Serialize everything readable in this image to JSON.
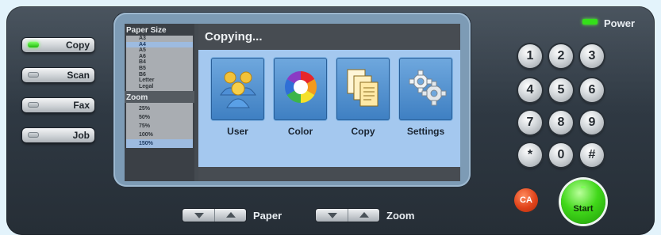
{
  "mode_buttons": [
    {
      "label": "Copy",
      "active": true
    },
    {
      "label": "Scan",
      "active": false
    },
    {
      "label": "Fax",
      "active": false
    },
    {
      "label": "Job",
      "active": false
    }
  ],
  "screen": {
    "paper_size_header": "Paper Size",
    "paper_sizes": [
      "A3",
      "A4",
      "A5",
      "A6",
      "B4",
      "B5",
      "B6",
      "Letter",
      "Legal"
    ],
    "selected_paper": "A4",
    "zoom_header": "Zoom",
    "zoom_levels": [
      "25%",
      "50%",
      "75%",
      "100%",
      "150%"
    ],
    "selected_zoom": "150%",
    "title": "Copying...",
    "tiles": [
      {
        "label": "User",
        "icon": "users-icon"
      },
      {
        "label": "Color",
        "icon": "color-wheel-icon"
      },
      {
        "label": "Copy",
        "icon": "documents-icon"
      },
      {
        "label": "Settings",
        "icon": "gears-icon"
      }
    ]
  },
  "power": {
    "label": "Power",
    "led_color": "#34e01a"
  },
  "keypad": [
    "1",
    "2",
    "3",
    "4",
    "5",
    "6",
    "7",
    "8",
    "9",
    "*",
    "0",
    "#"
  ],
  "clear_all": {
    "label": "CA"
  },
  "start": {
    "label": "Start"
  },
  "rockers": [
    {
      "label": "Paper"
    },
    {
      "label": "Zoom"
    }
  ],
  "colors": {
    "accent": "#a4c8ef",
    "start": "#41d81a",
    "clear": "#e0431a"
  }
}
